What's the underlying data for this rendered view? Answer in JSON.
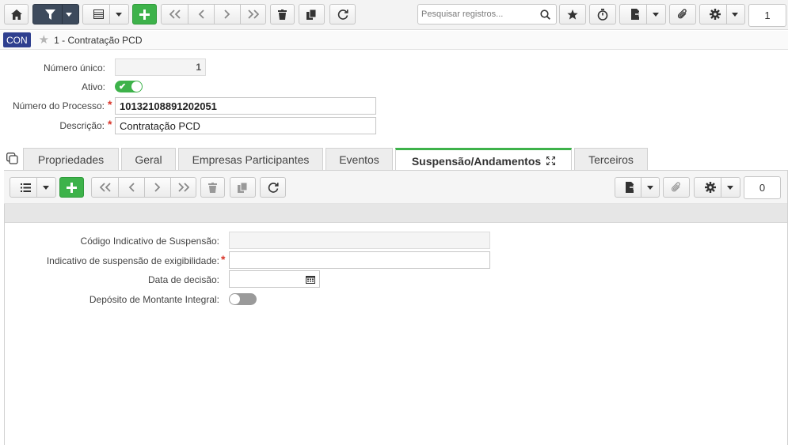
{
  "toolbar": {
    "search_placeholder": "Pesquisar registros...",
    "record_count": "1"
  },
  "header": {
    "badge": "CON",
    "title": "1 - Contratação PCD"
  },
  "form": {
    "numero_unico_label": "Número único:",
    "numero_unico_value": "1",
    "ativo_label": "Ativo:",
    "ativo_on": true,
    "numero_processo_label": "Número do Processo:",
    "numero_processo_value": "10132108891202051",
    "descricao_label": "Descrição:",
    "descricao_value": "Contratação PCD"
  },
  "tabs": [
    {
      "label": "Propriedades"
    },
    {
      "label": "Geral"
    },
    {
      "label": "Empresas Participantes"
    },
    {
      "label": "Eventos"
    },
    {
      "label": "Suspensão/Andamentos",
      "active": true
    },
    {
      "label": "Terceiros"
    }
  ],
  "subtoolbar": {
    "record_count": "0"
  },
  "detail": {
    "codigo_label": "Código Indicativo de Suspensão:",
    "codigo_value": "",
    "indicativo_label": "Indicativo de suspensão de exigibilidade:",
    "indicativo_value": "",
    "data_label": "Data de decisão:",
    "data_value": "",
    "deposito_label": "Depósito de Montante Integral:",
    "deposito_on": false
  },
  "colors": {
    "accent_green": "#3db24a",
    "badge_blue": "#2e3f8f",
    "required_red": "#d9362b"
  }
}
